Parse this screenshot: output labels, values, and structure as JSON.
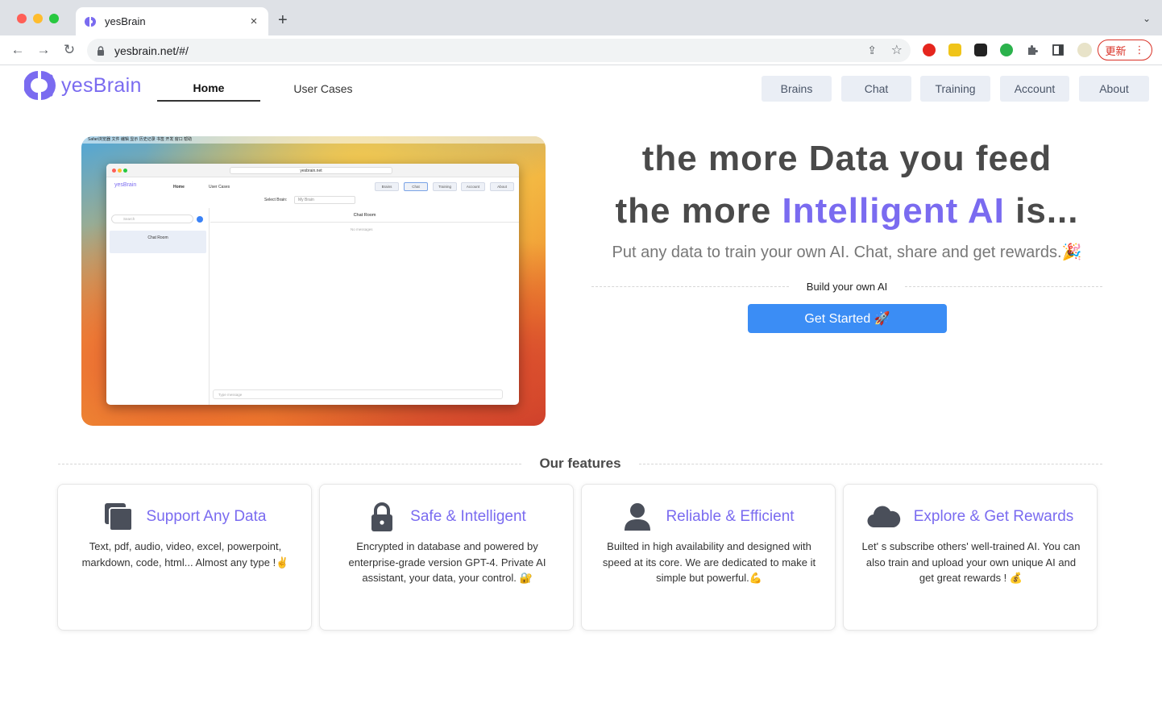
{
  "browser": {
    "tab_title": "yesBrain",
    "tab_close": "×",
    "new_tab": "+",
    "tab_menu": "⌄",
    "url": "yesbrain.net/#/",
    "back": "←",
    "forward": "→",
    "reload": "↻",
    "share": "⇪",
    "bookmark": "☆",
    "update_label": "更新",
    "menu": "⋮"
  },
  "site": {
    "logo_text": "yesBrain",
    "nav": {
      "home": "Home",
      "user_cases": "User Cases"
    },
    "menu": [
      "Brains",
      "Chat",
      "Training",
      "Account",
      "About"
    ]
  },
  "hero": {
    "headline_line1": "the more Data you feed",
    "headline_line2_prefix": "the more ",
    "headline_line2_accent": "Intelligent AI",
    "headline_line2_suffix": " is...",
    "subline": "Put any data to train your own AI. Chat, share and get rewards.🎉",
    "divider_label": "Build your own AI",
    "cta_label": "Get Started 🚀"
  },
  "preview": {
    "menubar": "Safari浏览器   文件   编辑   显示   历史记录   书签   开发   窗口   帮助",
    "url": "yesbrain.net",
    "logo_text": "yesBrain",
    "nav_home": "Home",
    "nav_cases": "User Cases",
    "menu": [
      "Brains",
      "Chat",
      "Training",
      "Account",
      "About"
    ],
    "select_label": "Select Brain:",
    "select_value": "My Brain",
    "search_placeholder": "Search",
    "room_name": "Chat Room",
    "chat_title": "Chat Room",
    "empty_text": "No messages",
    "input_placeholder": "Type message"
  },
  "features": {
    "title": "Our features",
    "cards": [
      {
        "icon": "copy-icon",
        "title": "Support Any Data",
        "body": "Text, pdf, audio, video, excel, powerpoint, markdown, code, html... Almost any type !✌️"
      },
      {
        "icon": "lock-icon",
        "title": "Safe & Intelligent",
        "body": "Encrypted in database and powered by enterprise-grade version GPT-4. Private AI assistant, your data, your control. 🔐"
      },
      {
        "icon": "user-icon",
        "title": "Reliable & Efficient",
        "body": "Builted in high availability and designed with speed at its core. We are dedicated to make it simple but powerful.💪"
      },
      {
        "icon": "cloud-icon",
        "title": "Explore & Get Rewards",
        "body": "Let' s subscribe others' well-trained AI. You can also train and upload your own unique AI and get great rewards ! 💰"
      }
    ]
  },
  "colors": {
    "accent": "#7a6bf0",
    "cta": "#3b8df5",
    "pill_bg": "#eaeef5",
    "update_red": "#d93025"
  }
}
